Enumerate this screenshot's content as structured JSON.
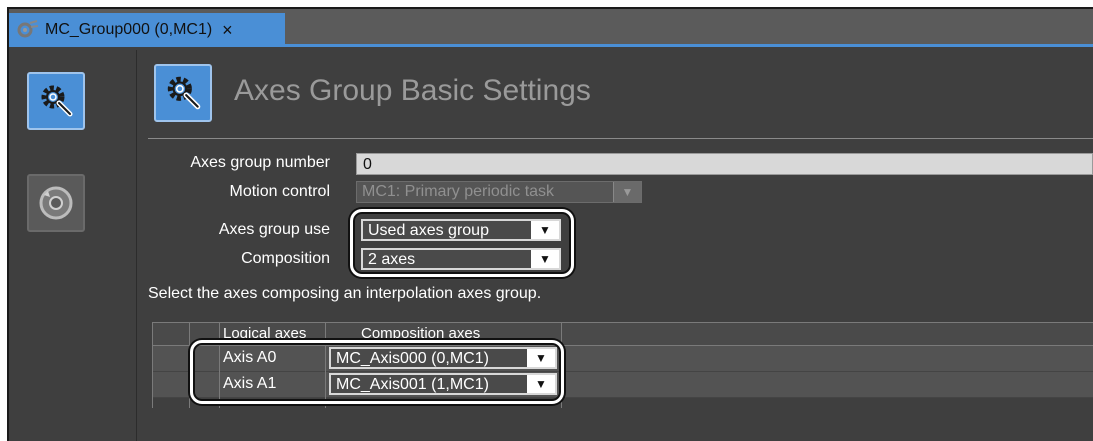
{
  "tab": {
    "title": "MC_Group000 (0,MC1)",
    "close_glyph": "×",
    "icon": "gear-plug-icon"
  },
  "sidebar": {
    "items": [
      {
        "name": "basic-settings",
        "icon": "gear-magnifier-icon",
        "active": true
      },
      {
        "name": "operation-settings",
        "icon": "circular-arrow-icon",
        "active": false
      }
    ]
  },
  "page": {
    "title": "Axes Group Basic Settings",
    "title_icon": "gear-magnifier-icon"
  },
  "form": {
    "axes_group_number_label": "Axes group number",
    "axes_group_number_value": "0",
    "motion_control_label": "Motion control",
    "motion_control_value": "MC1: Primary periodic task",
    "axes_group_use_label": "Axes group use",
    "axes_group_use_value": "Used axes group",
    "composition_label": "Composition",
    "composition_value": "2 axes",
    "dropdown_glyph": "▼"
  },
  "instruction": "Select the axes composing an interpolation axes group.",
  "axes_table": {
    "columns": [
      "Logical axes",
      "Composition axes"
    ],
    "rows": [
      {
        "logical": "Axis A0",
        "composition": "MC_Axis000 (0,MC1)"
      },
      {
        "logical": "Axis A1",
        "composition": "MC_Axis001 (1,MC1)"
      }
    ]
  },
  "colors": {
    "accent": "#4a8fd6",
    "panel_bg": "#3f3f3f",
    "highlight_outline": "#ffffff"
  }
}
